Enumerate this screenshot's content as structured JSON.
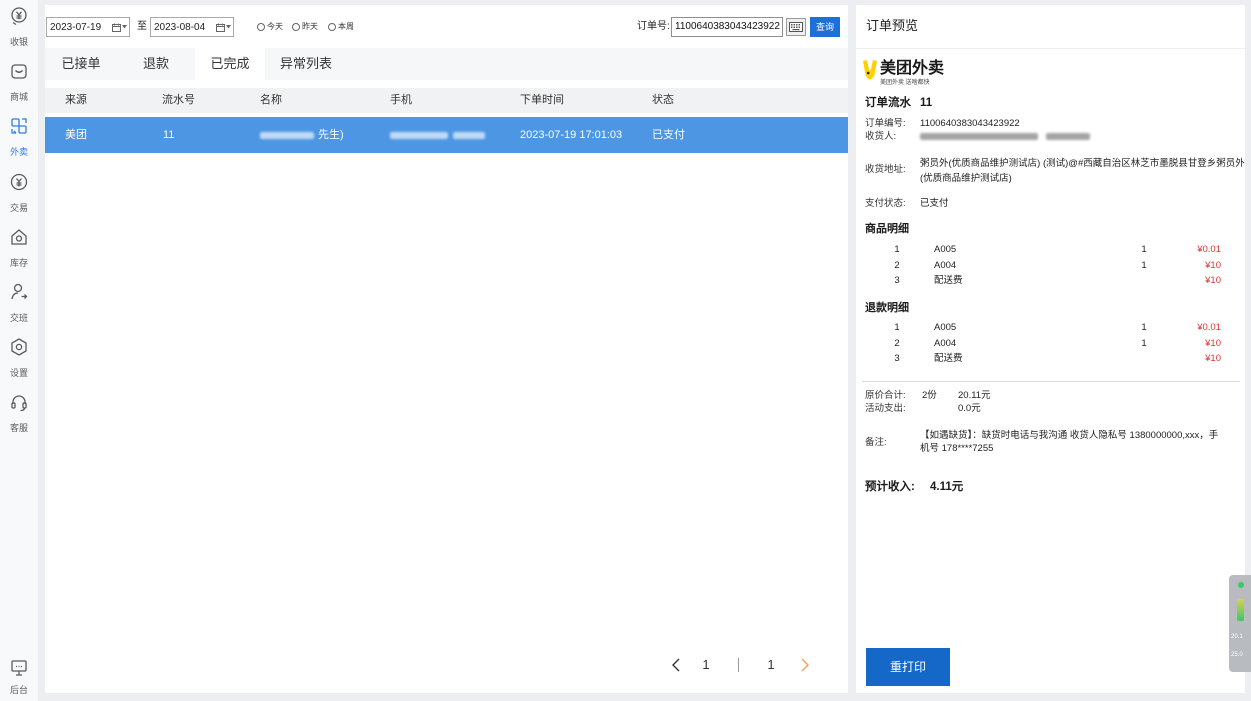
{
  "sidebar": {
    "items": [
      {
        "label": "收银",
        "icon": "cashier-icon",
        "active": false
      },
      {
        "label": "商城",
        "icon": "mall-icon",
        "active": false
      },
      {
        "label": "外卖",
        "icon": "takeout-icon",
        "active": true
      },
      {
        "label": "交易",
        "icon": "transaction-icon",
        "active": false
      },
      {
        "label": "库存",
        "icon": "inventory-icon",
        "active": false
      },
      {
        "label": "交班",
        "icon": "shift-handover-icon",
        "active": false
      },
      {
        "label": "设置",
        "icon": "settings-icon",
        "active": false
      },
      {
        "label": "客服",
        "icon": "customer-service-icon",
        "active": false
      }
    ],
    "bottom": {
      "label": "后台",
      "icon": "backend-icon"
    }
  },
  "filter": {
    "start_date": "2023-07-19",
    "range_separator": "至",
    "end_date": "2023-08-04",
    "quick_ranges": [
      {
        "label": "今天",
        "selected": false
      },
      {
        "label": "昨天",
        "selected": false
      },
      {
        "label": "本周",
        "selected": false
      }
    ],
    "order_no_label": "订单号:",
    "order_no_value": "1100640383043423922",
    "keyboard_icon": "keyboard-icon",
    "search_button": "查询"
  },
  "tabs": [
    {
      "label": "已接单",
      "active": false
    },
    {
      "label": "退款",
      "active": false
    },
    {
      "label": "已完成",
      "active": true
    },
    {
      "label": "异常列表",
      "active": false
    }
  ],
  "order_table": {
    "columns": [
      "来源",
      "流水号",
      "名称",
      "手机",
      "下单时间",
      "状态"
    ],
    "rows": [
      {
        "source": "美团",
        "serial": "11",
        "name_visible": "先生)",
        "order_time": "2023-07-19 17:01:03",
        "status": "已支付",
        "selected": true
      }
    ]
  },
  "pagination": {
    "current_page": "1",
    "total_pages": "1"
  },
  "preview": {
    "title": "订单预览",
    "platform_logo": {
      "name": "美团外卖",
      "slogan": "美团外卖 送啥都快"
    },
    "serial_label": "订单流水",
    "serial_value": "11",
    "order_no_label": "订单编号:",
    "order_no_value": "1100640383043423922",
    "receiver_label": "收货人:",
    "address_label": "收货地址:",
    "address_lines": [
      "粥员外(优质商品维护测试店) (测试)@#西藏自治区林芝市墨脱县甘登乡粥员外",
      "(优质商品维护测试店)"
    ],
    "payment_status_label": "支付状态:",
    "payment_status_value": "已支付",
    "goods_title": "商品明细",
    "goods": [
      {
        "no": "1",
        "name": "A005",
        "qty": "1",
        "price": "¥0.01"
      },
      {
        "no": "2",
        "name": "A004",
        "qty": "1",
        "price": "¥10"
      },
      {
        "no": "3",
        "name": "配送费",
        "qty": "",
        "price": "¥10"
      }
    ],
    "refund_title": "退款明细",
    "refunds": [
      {
        "no": "1",
        "name": "A005",
        "qty": "1",
        "price": "¥0.01"
      },
      {
        "no": "2",
        "name": "A004",
        "qty": "1",
        "price": "¥10"
      },
      {
        "no": "3",
        "name": "配送费",
        "qty": "",
        "price": "¥10"
      }
    ],
    "original_total_label": "原价合计:",
    "original_total_qty": "2份",
    "original_total_amount": "20.11元",
    "discount_label": "活动支出:",
    "discount_amount": "0.0元",
    "remark_label": "备注:",
    "remark_lines": [
      "【如遇缺货】：缺货时电话与我沟通 收货人隐私号 1380000000,xxx，手",
      "机号 178****7255"
    ],
    "expected_income_label": "预计收入:",
    "expected_income_value": "4.11元",
    "reprint_button": "重打印"
  },
  "monitor_widget": {
    "value_1": "20.1",
    "value_2": "25.0"
  },
  "colors": {
    "accent": "#2f7de1",
    "selected_row": "#4c96e3",
    "search_button": "#1e6fd9",
    "reprint_button": "#1668c8",
    "price_red": "#e33333",
    "pagination_next": "#f5a356",
    "logo_yellow": "#ffd100"
  }
}
